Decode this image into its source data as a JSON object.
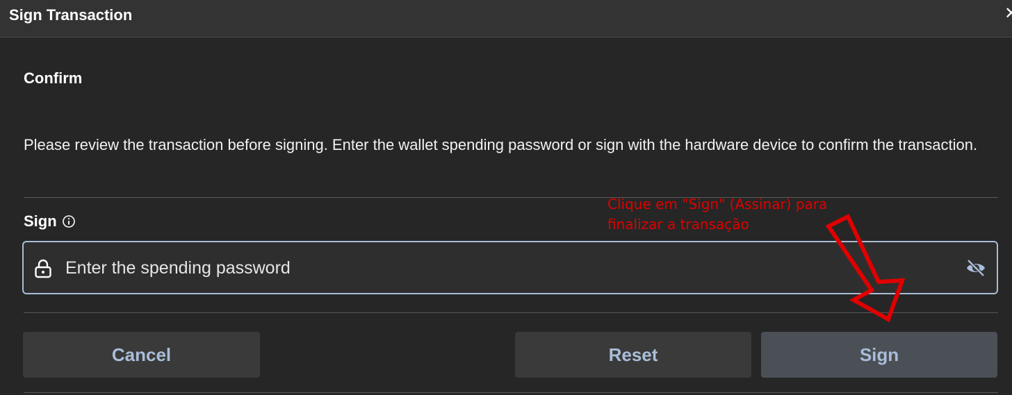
{
  "dialog": {
    "title": "Sign Transaction",
    "close_icon": "close-icon",
    "section_heading": "Confirm",
    "description": "Please review the transaction before signing. Enter the wallet spending password or sign with the hardware device to confirm the transaction."
  },
  "sign": {
    "label": "Sign",
    "info_icon": "info-icon",
    "password_placeholder": "Enter the spending password",
    "password_value": "",
    "lock_icon": "lock-icon",
    "visibility_icon": "eye-off-icon"
  },
  "buttons": {
    "cancel": "Cancel",
    "reset": "Reset",
    "sign": "Sign"
  },
  "annotation": {
    "text_line1": "Clique em \"Sign\" (Assinar) para",
    "text_line2": "finalizar a transação",
    "color": "#e00000"
  },
  "colors": {
    "background": "#262626",
    "titlebar": "#333333",
    "accent_text": "#a9bdd8",
    "field_border": "#a9bdd8"
  }
}
